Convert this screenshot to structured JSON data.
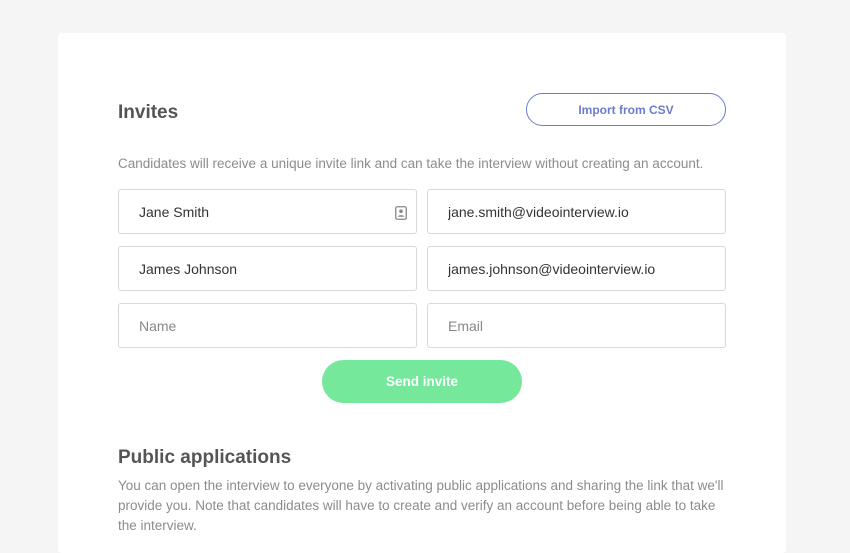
{
  "invites": {
    "title": "Invites",
    "import_button_label": "Import from CSV",
    "description": "Candidates will receive a unique invite link and can take the interview without creating an account.",
    "rows": [
      {
        "name": "Jane Smith",
        "email": "jane.smith@videointerview.io"
      },
      {
        "name": "James Johnson",
        "email": "james.johnson@videointerview.io"
      },
      {
        "name": "",
        "email": ""
      }
    ],
    "name_placeholder": "Name",
    "email_placeholder": "Email",
    "contact_icon": "contact-card-icon",
    "send_button_label": "Send invite",
    "send_button_color": "#76e89c",
    "accent_color": "#6b7ccc"
  },
  "public_applications": {
    "title": "Public applications",
    "description": "You can open the interview to everyone by activating public applications and sharing the link that we'll provide you. Note that candidates will have to create and verify an account before being able to take the interview."
  }
}
